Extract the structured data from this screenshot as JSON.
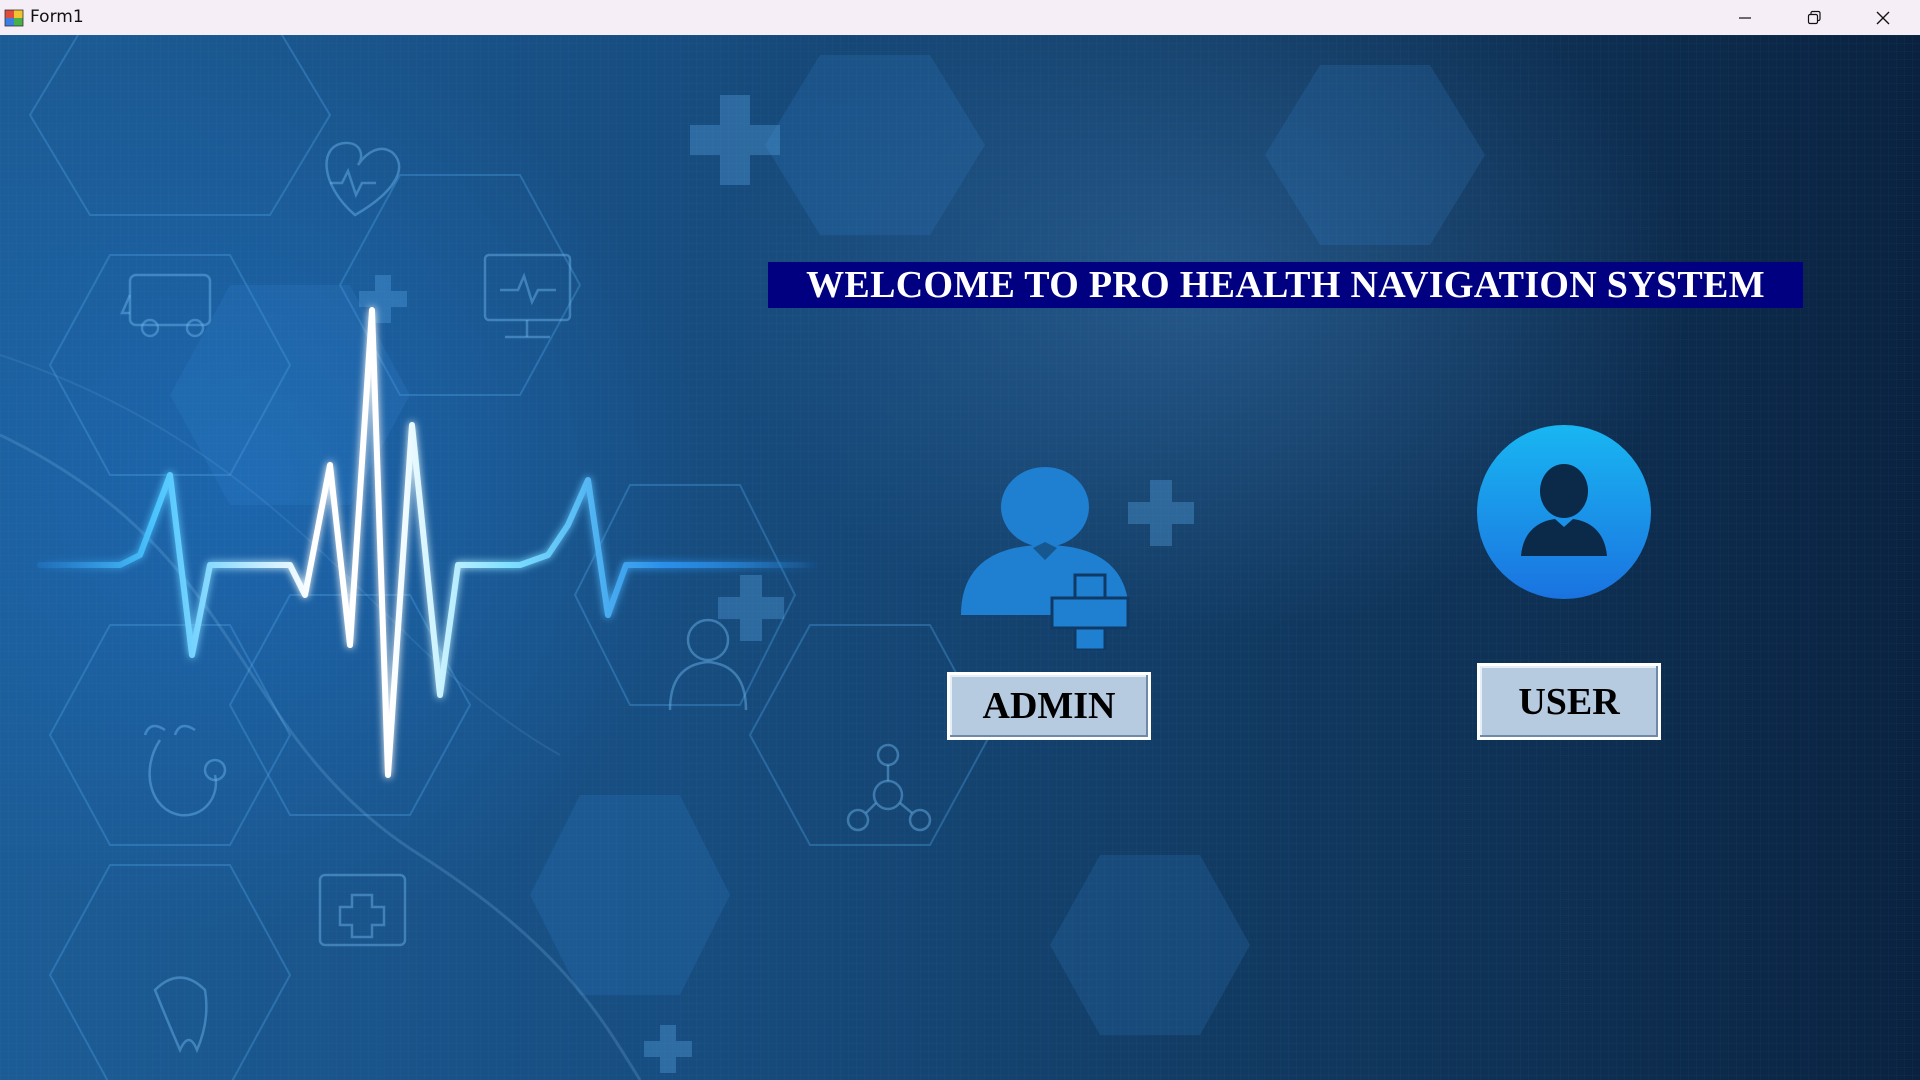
{
  "window": {
    "title": "Form1",
    "controls": {
      "minimize_icon": "minimize-icon",
      "maximize_icon": "restore-icon",
      "close_icon": "close-icon"
    }
  },
  "main": {
    "welcome_text": "WELCOME TO PRO HEALTH NAVIGATION SYSTEM",
    "admin": {
      "icon": "admin-add-user-icon",
      "label": "ADMIN"
    },
    "user": {
      "icon": "user-avatar-icon",
      "label": "USER"
    }
  },
  "colors": {
    "banner_bg": "#010080",
    "banner_text": "#ffffff",
    "button_bg": "#b7cbe0",
    "admin_icon": "#1f7fd0",
    "user_icon_gradient_top": "#19b6f2",
    "user_icon_gradient_bottom": "#1a73e0",
    "background_dark": "#0a2240",
    "background_light": "#1c5c96"
  }
}
